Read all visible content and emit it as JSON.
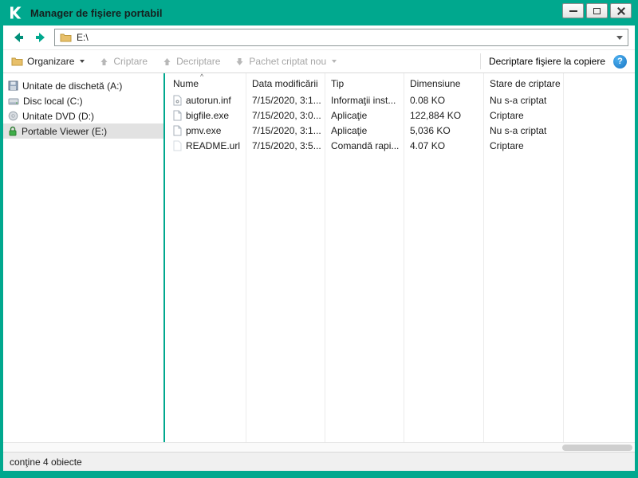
{
  "window": {
    "title": "Manager de fişiere portabil"
  },
  "colors": {
    "brand": "#00a88e",
    "help_blue": "#1f8fdd",
    "lock_green": "#3fae49"
  },
  "navbar": {
    "address": "E:\\"
  },
  "toolbar": {
    "organize_label": "Organizare",
    "encrypt_label": "Criptare",
    "decrypt_label": "Decriptare",
    "new_package_label": "Pachet criptat nou",
    "decrypt_on_copy_label": "Decriptare fişiere la copiere",
    "help_glyph": "?"
  },
  "sidebar": {
    "items": [
      {
        "label": "Unitate de dischetă (A:)",
        "icon": "floppy-icon"
      },
      {
        "label": "Disc local (C:)",
        "icon": "hard-disk-icon"
      },
      {
        "label": "Unitate DVD (D:)",
        "icon": "dvd-icon"
      },
      {
        "label": "Portable Viewer (E:)",
        "icon": "lock-icon",
        "selected": true
      }
    ]
  },
  "filelist": {
    "sort_indicator": "^",
    "columns": [
      "Nume",
      "Data modificării",
      "Tip",
      "Dimensiune",
      "Stare de criptare"
    ],
    "rows": [
      {
        "name": "autorun.inf",
        "modified": "7/15/2020, 3:1...",
        "type": "Informaţii inst...",
        "size": "0.08 KO",
        "status": "Nu s-a criptat"
      },
      {
        "name": "bigfile.exe",
        "modified": "7/15/2020, 3:0...",
        "type": "Aplicaţie",
        "size": "122,884 KO",
        "status": "Criptare"
      },
      {
        "name": "pmv.exe",
        "modified": "7/15/2020, 3:1...",
        "type": "Aplicaţie",
        "size": "5,036 KO",
        "status": "Nu s-a criptat"
      },
      {
        "name": "README.url",
        "modified": "7/15/2020, 3:5...",
        "type": "Comandă rapi...",
        "size": "4.07 KO",
        "status": "Criptare"
      }
    ]
  },
  "statusbar": {
    "text": "conţine 4 obiecte"
  }
}
